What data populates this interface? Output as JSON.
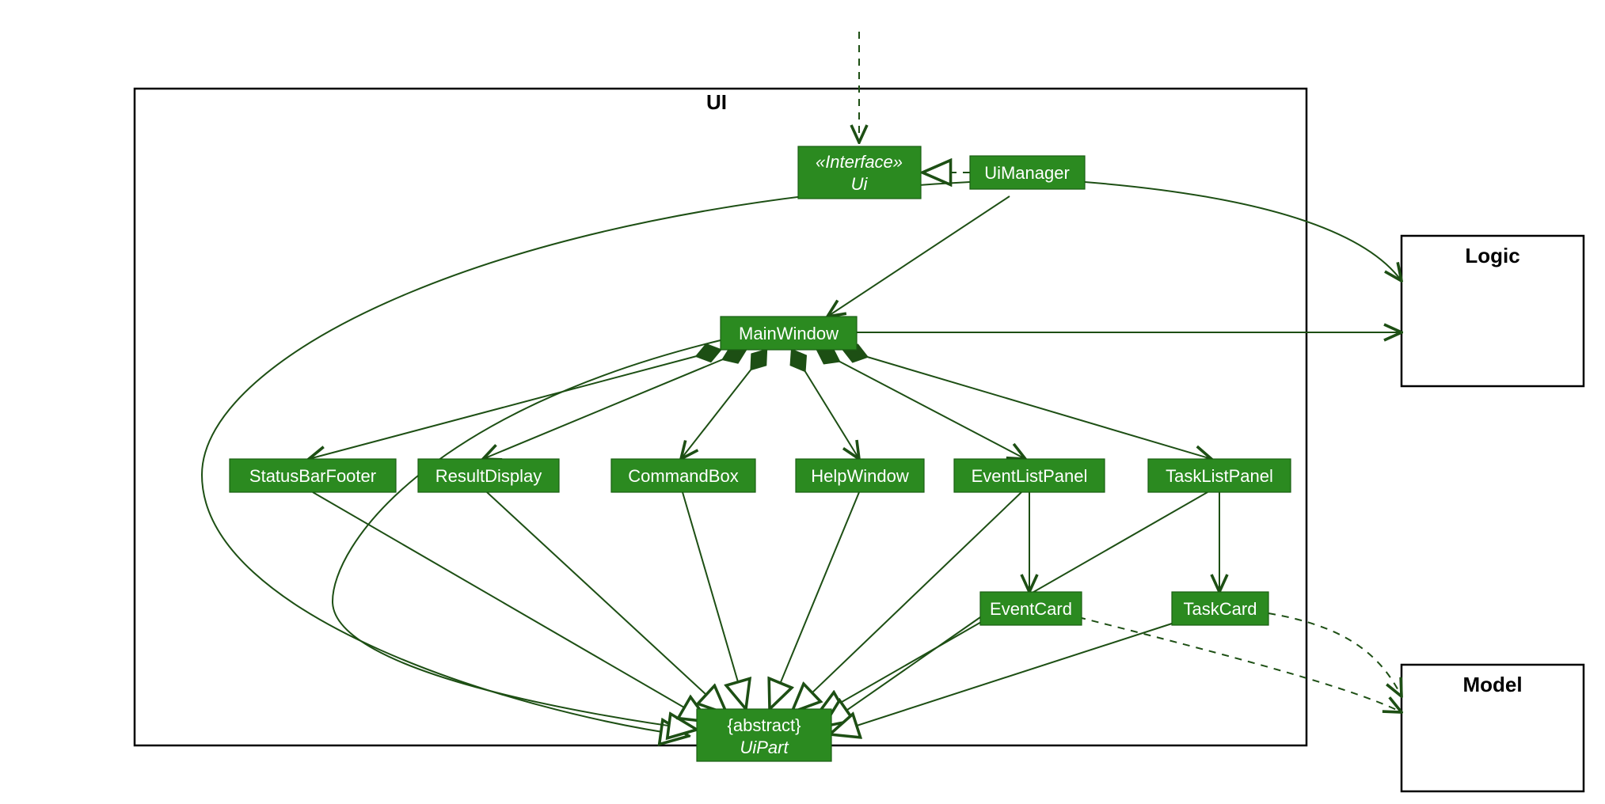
{
  "packages": {
    "ui_label": "UI",
    "logic_label": "Logic",
    "model_label": "Model"
  },
  "classes": {
    "ui_interface": {
      "stereotype": "«Interface»",
      "name": "Ui"
    },
    "ui_manager": "UiManager",
    "main_window": "MainWindow",
    "status_bar_footer": "StatusBarFooter",
    "result_display": "ResultDisplay",
    "command_box": "CommandBox",
    "help_window": "HelpWindow",
    "event_list_panel": "EventListPanel",
    "task_list_panel": "TaskListPanel",
    "event_card": "EventCard",
    "task_card": "TaskCard",
    "ui_part": {
      "stereotype": "{abstract}",
      "name": "UiPart"
    }
  },
  "diagram": {
    "relationships": [
      {
        "from": "external",
        "to": "Ui",
        "type": "dependency"
      },
      {
        "from": "UiManager",
        "to": "Ui",
        "type": "realization"
      },
      {
        "from": "UiManager",
        "to": "MainWindow",
        "type": "association_directed"
      },
      {
        "from": "UiManager",
        "to": "Logic",
        "type": "association_directed"
      },
      {
        "from": "MainWindow",
        "to": "Logic",
        "type": "association_directed"
      },
      {
        "from": "MainWindow",
        "to": "StatusBarFooter",
        "type": "composition"
      },
      {
        "from": "MainWindow",
        "to": "ResultDisplay",
        "type": "composition"
      },
      {
        "from": "MainWindow",
        "to": "CommandBox",
        "type": "composition"
      },
      {
        "from": "MainWindow",
        "to": "HelpWindow",
        "type": "composition"
      },
      {
        "from": "MainWindow",
        "to": "EventListPanel",
        "type": "composition"
      },
      {
        "from": "MainWindow",
        "to": "TaskListPanel",
        "type": "composition"
      },
      {
        "from": "EventListPanel",
        "to": "EventCard",
        "type": "association_directed"
      },
      {
        "from": "TaskListPanel",
        "to": "TaskCard",
        "type": "association_directed"
      },
      {
        "from": "EventCard",
        "to": "Model",
        "type": "dependency"
      },
      {
        "from": "TaskCard",
        "to": "Model",
        "type": "dependency"
      },
      {
        "from": "MainWindow",
        "to": "UiPart",
        "type": "generalization"
      },
      {
        "from": "StatusBarFooter",
        "to": "UiPart",
        "type": "generalization"
      },
      {
        "from": "ResultDisplay",
        "to": "UiPart",
        "type": "generalization"
      },
      {
        "from": "CommandBox",
        "to": "UiPart",
        "type": "generalization"
      },
      {
        "from": "HelpWindow",
        "to": "UiPart",
        "type": "generalization"
      },
      {
        "from": "EventListPanel",
        "to": "UiPart",
        "type": "generalization"
      },
      {
        "from": "TaskListPanel",
        "to": "UiPart",
        "type": "generalization"
      },
      {
        "from": "EventCard",
        "to": "UiPart",
        "type": "generalization"
      },
      {
        "from": "TaskCard",
        "to": "UiPart",
        "type": "generalization"
      },
      {
        "from": "UiManager",
        "to": "UiPart",
        "type": "generalization"
      }
    ]
  }
}
